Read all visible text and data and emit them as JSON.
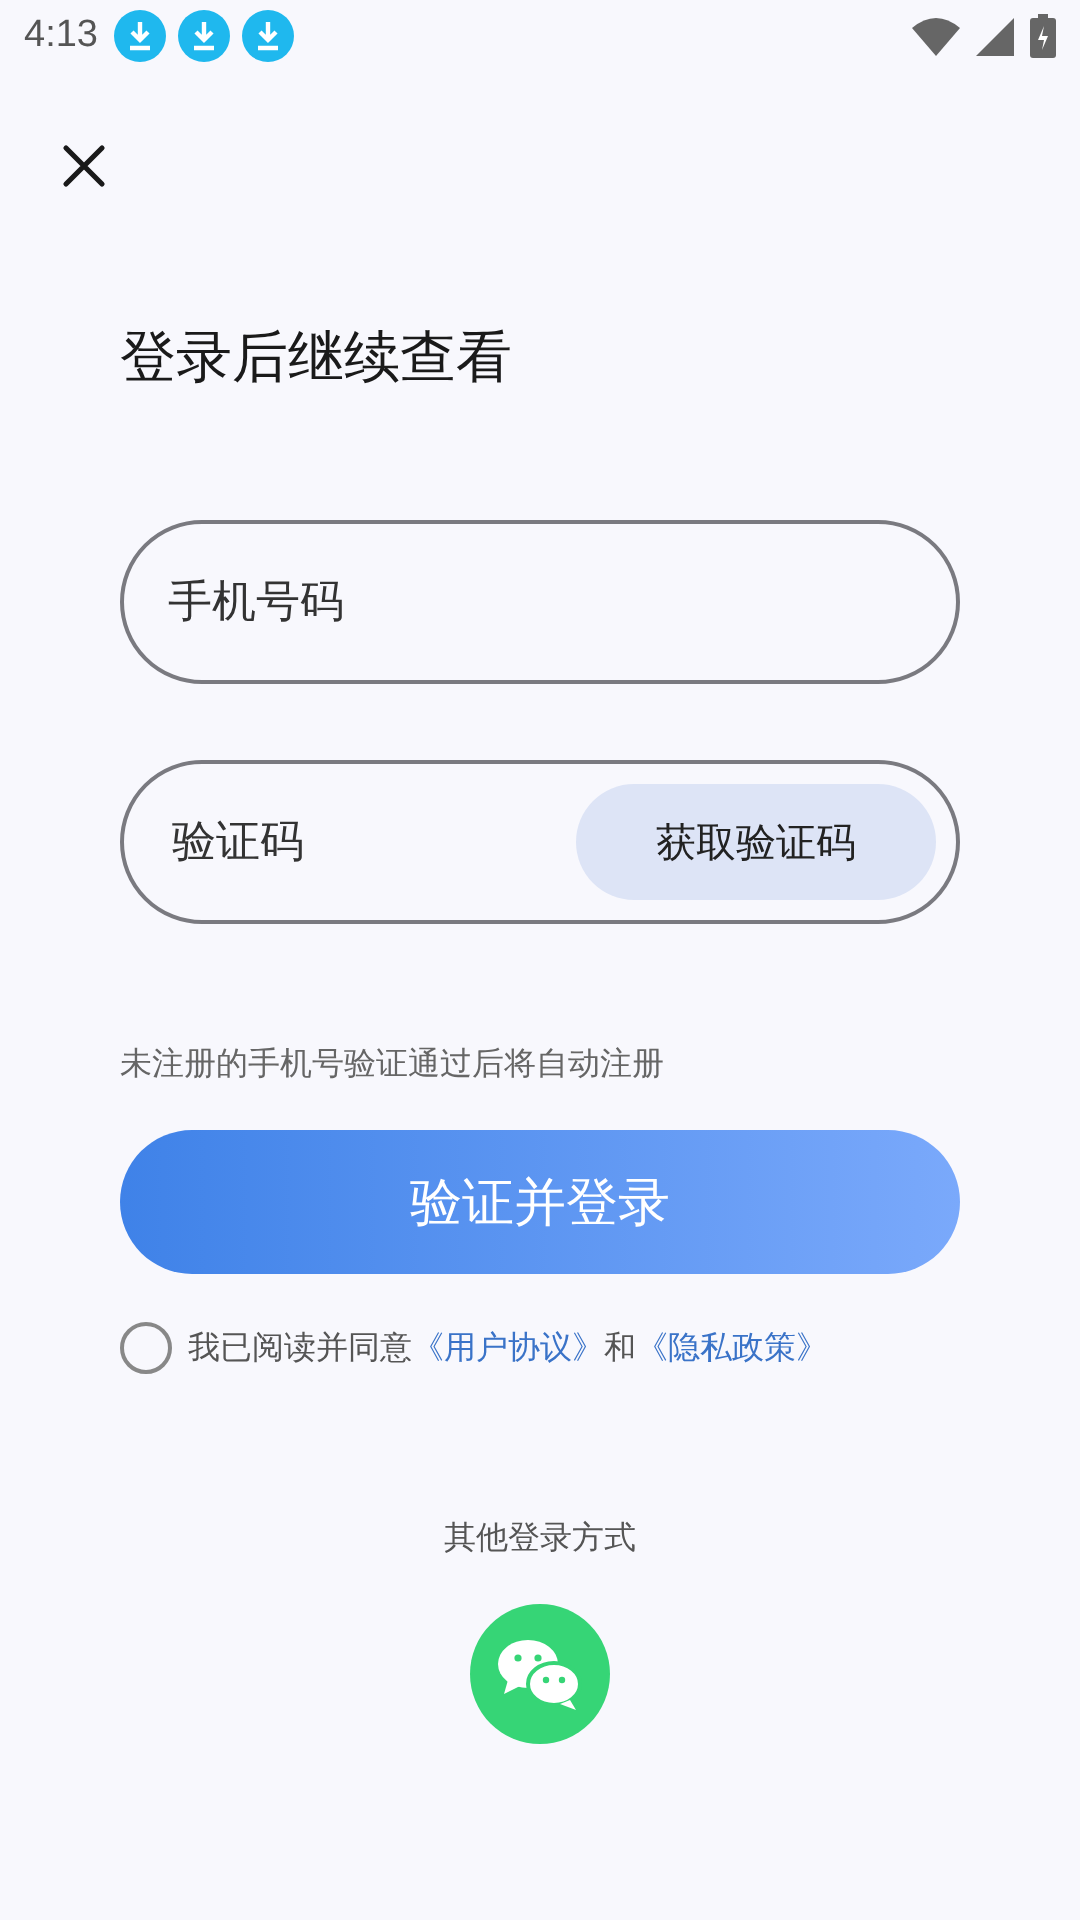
{
  "status_bar": {
    "time": "4:13",
    "notifications": [
      {
        "kind": "download"
      },
      {
        "kind": "download"
      },
      {
        "kind": "download"
      }
    ]
  },
  "title": "登录后继续查看",
  "phone_field": {
    "placeholder": "手机号码"
  },
  "code_field": {
    "placeholder": "验证码",
    "button": "获取验证码"
  },
  "hint": "未注册的手机号验证通过后将自动注册",
  "login_button": "验证并登录",
  "agreement": {
    "checked": false,
    "text": "我已阅读并同意",
    "link_1": "《用户协议》",
    "joiner": "和",
    "link_2": "《隐私政策》"
  },
  "other_login": {
    "label": "其他登录方式"
  }
}
